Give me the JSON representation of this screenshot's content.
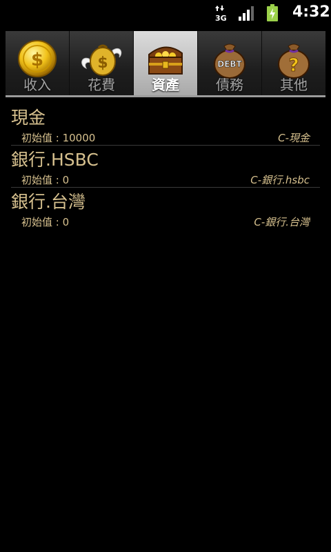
{
  "status_bar": {
    "network_label": "3G",
    "clock": "4:32",
    "icons": [
      "3g-data-icon",
      "signal-strength-icon",
      "battery-charging-icon"
    ]
  },
  "tabs": [
    {
      "label": "收入",
      "icon": "gold-coin-icon",
      "selected": false
    },
    {
      "label": "花費",
      "icon": "winged-money-bag-icon",
      "selected": false
    },
    {
      "label": "資產",
      "icon": "treasure-chest-icon",
      "selected": true
    },
    {
      "label": "債務",
      "icon": "debt-bag-icon",
      "selected": false
    },
    {
      "label": "其他",
      "icon": "question-bag-icon",
      "selected": false
    }
  ],
  "accounts": [
    {
      "name": "現金",
      "initial_value": "初始值 : 10000",
      "code": "C-現金"
    },
    {
      "name": "銀行.HSBC",
      "initial_value": "初始值 : 0",
      "code": "C-銀行.hsbc"
    },
    {
      "name": "銀行.台灣",
      "initial_value": "初始值 : 0",
      "code": "C-銀行.台灣"
    }
  ],
  "colors": {
    "background": "#000000",
    "text_gold": "#d6c08e",
    "tab_selected": "#c4c4c4",
    "tab_unselected": "#262626"
  }
}
